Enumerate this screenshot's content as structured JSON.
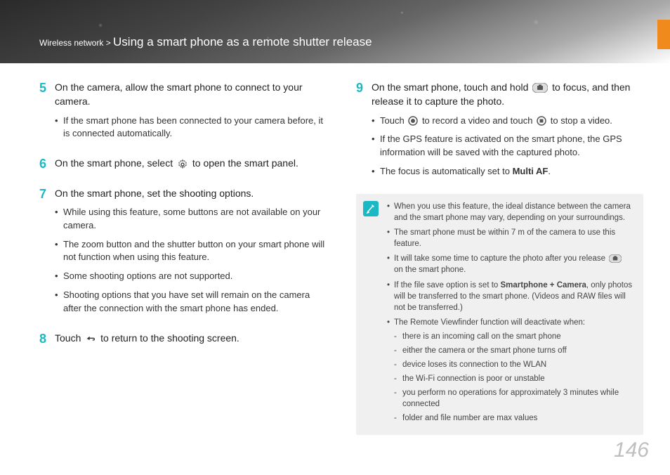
{
  "header": {
    "breadcrumb_prefix": "Wireless network > ",
    "title": "Using a smart phone as a remote shutter release"
  },
  "left": {
    "step5": {
      "num": "5",
      "text": "On the camera, allow the smart phone to connect to your camera.",
      "sub1": "If the smart phone has been connected to your camera before, it is connected automatically."
    },
    "step6": {
      "num": "6",
      "text_a": "On the smart phone, select ",
      "text_b": " to open the smart panel."
    },
    "step7": {
      "num": "7",
      "text": "On the smart phone, set the shooting options.",
      "sub1": "While using this feature, some buttons are not available on your camera.",
      "sub2": "The zoom button and the shutter button on your smart phone will not function when using this feature.",
      "sub3": "Some shooting options are not supported.",
      "sub4": "Shooting options that you have set will remain on the camera after the connection with the smart phone has ended."
    },
    "step8": {
      "num": "8",
      "text_a": "Touch ",
      "text_b": " to return to the shooting screen."
    }
  },
  "right": {
    "step9": {
      "num": "9",
      "text_a": "On the smart phone, touch and hold ",
      "text_b": " to focus, and then release it to capture the photo.",
      "sub1_a": "Touch ",
      "sub1_b": " to record a video and touch ",
      "sub1_c": " to stop a video.",
      "sub2": "If the GPS feature is activated on the smart phone, the GPS information will be saved with the captured photo.",
      "sub3_a": "The focus is automatically set to ",
      "sub3_bold": "Multi AF",
      "sub3_b": "."
    }
  },
  "notes": {
    "n1": "When you use this feature, the ideal distance between the camera and the smart phone may vary, depending on your surroundings.",
    "n2": "The smart phone must be within 7 m of the camera to use this feature.",
    "n3_a": "It will take some time to capture the photo after you release ",
    "n3_b": " on the smart phone.",
    "n4_a": "If the file save option is set to ",
    "n4_bold": "Smartphone + Camera",
    "n4_b": ", only photos will be transferred to the smart phone. (Videos and RAW files will not be transferred.)",
    "n5": "The Remote Viewfinder function will deactivate when:",
    "n5_s1": "there is an incoming call on the smart phone",
    "n5_s2": "either the camera or the smart phone turns off",
    "n5_s3": "device loses its connection to the WLAN",
    "n5_s4": "the Wi-Fi connection is poor or unstable",
    "n5_s5": "you perform no operations for approximately 3 minutes while connected",
    "n5_s6": "folder and file number are max values"
  },
  "page_number": "146"
}
